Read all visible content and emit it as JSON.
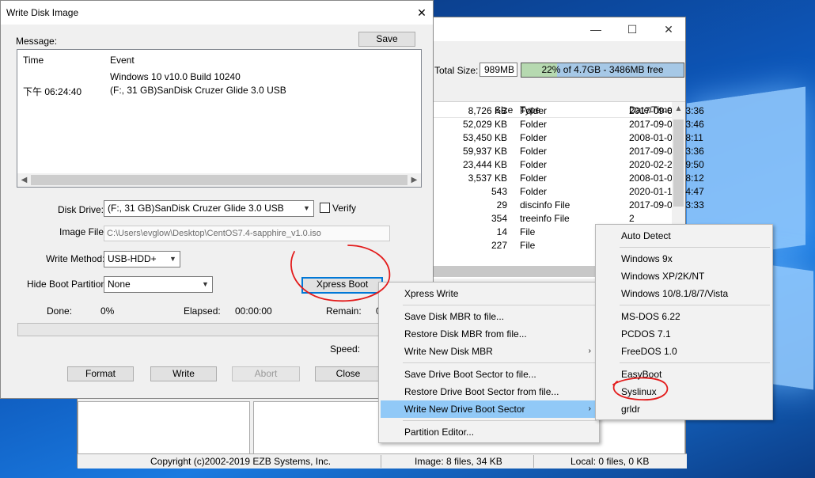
{
  "background_window": {
    "title_buttons": [
      "—",
      "☐",
      "✕"
    ],
    "total_size_label": "Total Size:",
    "total_size_value": "989MB",
    "capacity_fraction": 0.22,
    "capacity_text": "22% of 4.7GB - 3486MB free",
    "columns": [
      "Size",
      "Type",
      "Date/Time"
    ],
    "rows": [
      {
        "size": "8,726 KB",
        "type": "Folder",
        "date": "2017-09-06 13:36"
      },
      {
        "size": "52,029 KB",
        "type": "Folder",
        "date": "2017-09-06 13:46"
      },
      {
        "size": "53,450 KB",
        "type": "Folder",
        "date": "2008-01-01 08:11"
      },
      {
        "size": "59,937 KB",
        "type": "Folder",
        "date": "2017-09-06 13:36"
      },
      {
        "size": "23,444 KB",
        "type": "Folder",
        "date": "2020-02-25 19:50"
      },
      {
        "size": "3,537 KB",
        "type": "Folder",
        "date": "2008-01-01 08:12"
      },
      {
        "size": "543",
        "type": "Folder",
        "date": "2020-01-19 04:47"
      },
      {
        "size": "29",
        "type": "discinfo File",
        "date": "2017-09-06 13:33"
      },
      {
        "size": "354",
        "type": "treeinfo File",
        "date": "2"
      },
      {
        "size": "14",
        "type": "File",
        "date": "2"
      },
      {
        "size": "227",
        "type": "File",
        "date": ""
      }
    ],
    "status": {
      "copyright": "Copyright (c)2002-2019 EZB Systems, Inc.",
      "image": "Image: 8 files, 34 KB",
      "local": "Local: 0 files, 0 KB"
    }
  },
  "dialog": {
    "title": "Write Disk Image",
    "close": "✕",
    "message_label": "Message:",
    "save_button": "Save",
    "log_columns": [
      "Time",
      "Event"
    ],
    "log_rows": [
      {
        "time": "",
        "event": "Windows 10 v10.0 Build 10240"
      },
      {
        "time": "下午 06:24:40",
        "event": "(F:, 31 GB)SanDisk Cruzer Glide 3.0 USB"
      }
    ],
    "disk_drive_label": "Disk Drive:",
    "disk_drive_value": "(F:, 31 GB)SanDisk Cruzer Glide 3.0 USB",
    "verify_label": "Verify",
    "image_file_label": "Image File:",
    "image_file_value": "C:\\Users\\evglow\\Desktop\\CentOS7.4-sapphire_v1.0.iso",
    "write_method_label": "Write Method:",
    "write_method_value": "USB-HDD+",
    "hide_boot_label": "Hide Boot Partition:",
    "hide_boot_value": "None",
    "xpress_boot_button": "Xpress Boot",
    "done_label": "Done:",
    "done_value": "0%",
    "elapsed_label": "Elapsed:",
    "elapsed_value": "00:00:00",
    "remain_label": "Remain:",
    "remain_value": "0",
    "speed_label": "Speed:",
    "progress_fraction": 0,
    "buttons": {
      "format": "Format",
      "write": "Write",
      "abort": "Abort",
      "close": "Close"
    }
  },
  "xpress_menu": {
    "items": [
      "Xpress Write",
      "Save Disk MBR to file...",
      "Restore Disk MBR from file...",
      "Write New Disk MBR",
      "Save Drive Boot Sector to file...",
      "Restore Drive Boot Sector from file...",
      "Write New Drive Boot Sector",
      "Partition Editor..."
    ],
    "submenu_arrow": "›"
  },
  "boot_submenu": {
    "items": [
      "Auto Detect",
      "Windows 9x",
      "Windows XP/2K/NT",
      "Windows 10/8.1/8/7/Vista",
      "MS-DOS 6.22",
      "PCDOS 7.1",
      "FreeDOS 1.0",
      "EasyBoot",
      "Syslinux",
      "grldr"
    ]
  },
  "colors": {
    "menu_highlight": "#91c9f7",
    "annotation_red": "#e31b1b",
    "focus_blue": "#0078d7"
  }
}
